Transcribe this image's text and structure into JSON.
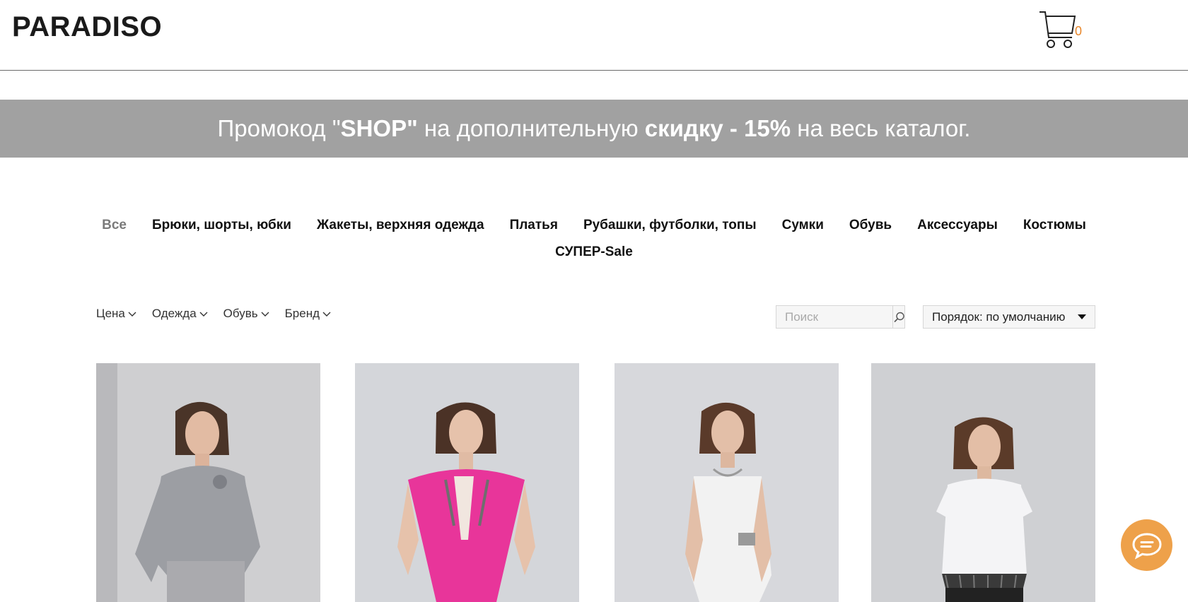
{
  "header": {
    "logo": "PARADISO",
    "cart_count": "0"
  },
  "promo": {
    "part1": "Промокод \"",
    "code": "SHOP\"",
    "part2": " на дополнительную ",
    "discount": "скидку - 15%",
    "part3": " на весь каталог."
  },
  "categories": {
    "row1": [
      "Все",
      "Брюки, шорты, юбки",
      "Жакеты, верхняя одежда",
      "Платья",
      "Рубашки, футболки, топы",
      "Сумки",
      "Обувь",
      "Аксессуары",
      "Костюмы"
    ],
    "row2": [
      "СУПЕР-Sale"
    ],
    "active": "Все"
  },
  "filters": [
    "Цена",
    "Одежда",
    "Обувь",
    "Бренд"
  ],
  "search": {
    "placeholder": "Поиск"
  },
  "sort": {
    "label": "Порядок: по умолчанию"
  },
  "products": [
    {
      "image": "model in grey striped blouse with brooch and grey trousers",
      "garment_color": "#9c9ea3"
    },
    {
      "image": "model in pink sleeveless long vest jacket",
      "garment_color": "#e8359a"
    },
    {
      "image": "model in white wrap sleeveless top with belt buckle",
      "garment_color": "#f2f2f2"
    },
    {
      "image": "model in white short-sleeve top with feather hem",
      "garment_color": "#f4f4f6"
    }
  ],
  "colors": {
    "accent": "#e8862a",
    "promo_bg": "#a1a1a1",
    "chat": "#eea14a"
  }
}
